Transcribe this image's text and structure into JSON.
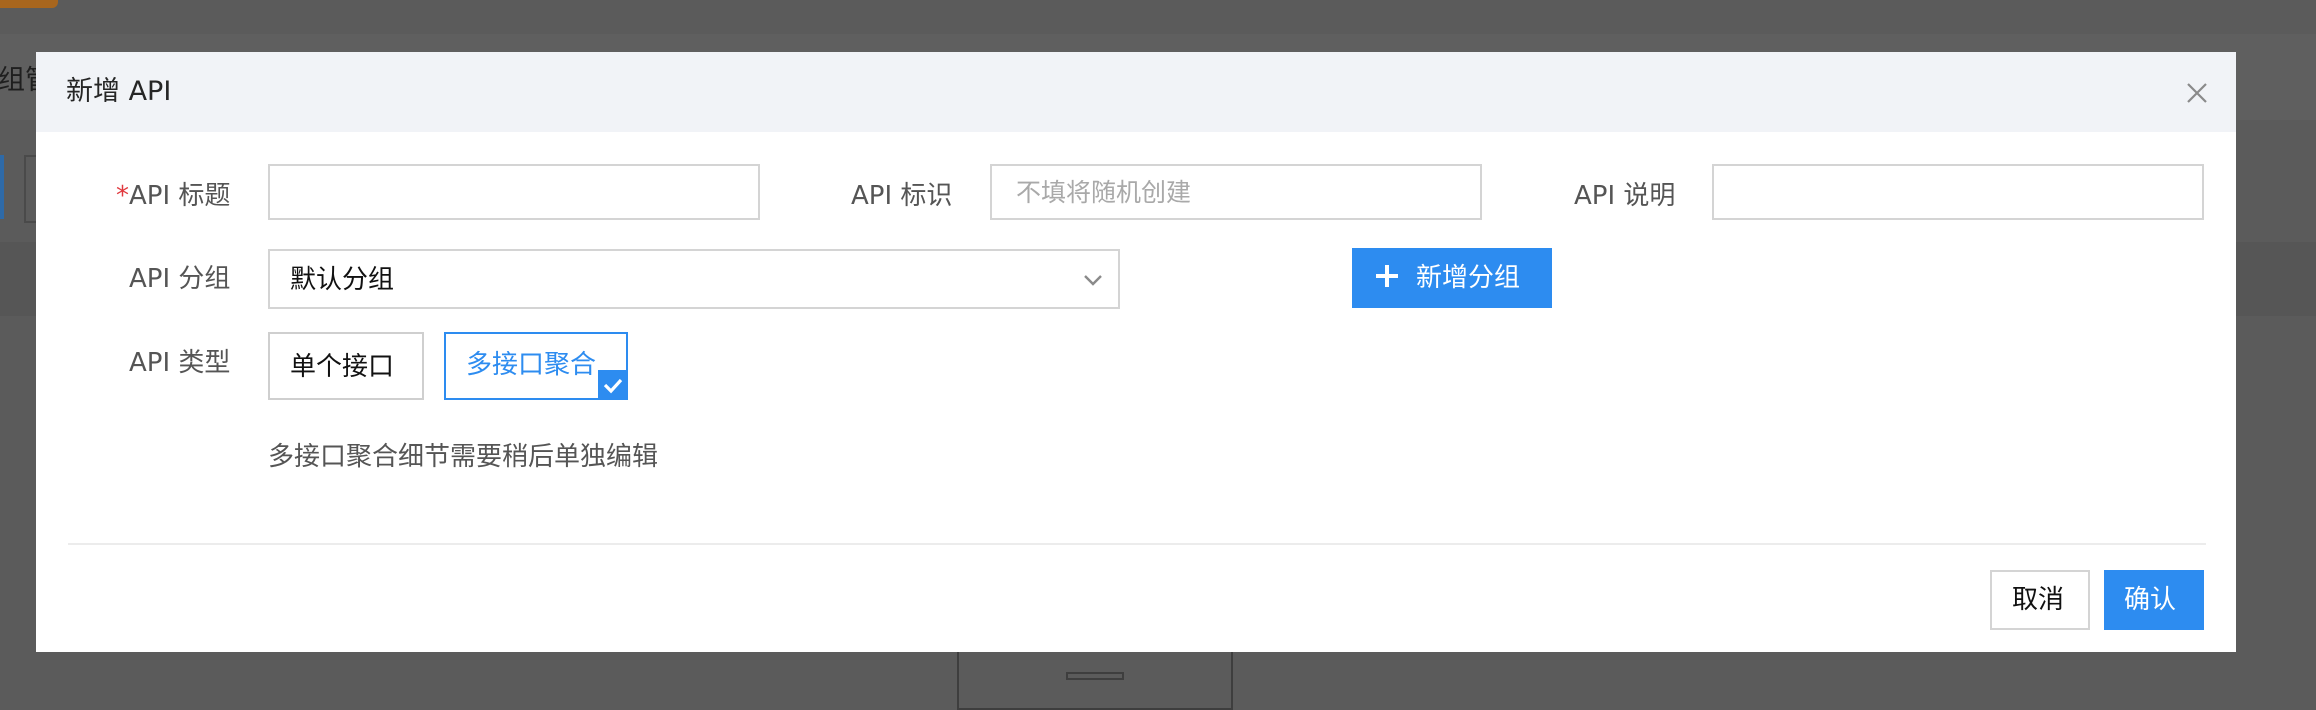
{
  "background": {
    "tab_text": "组管"
  },
  "dialog": {
    "title": "新增 API",
    "close_icon": "close-icon",
    "fields": {
      "title": {
        "required_mark": "*",
        "label": "API 标题",
        "value": "",
        "placeholder": ""
      },
      "identifier": {
        "label": "API 标识",
        "value": "",
        "placeholder": "不填将随机创建"
      },
      "description": {
        "label": "API 说明",
        "value": "",
        "placeholder": ""
      },
      "group": {
        "label": "API 分组",
        "selected": "默认分组"
      },
      "type": {
        "label": "API 类型",
        "options": [
          "单个接口",
          "多接口聚合"
        ],
        "selected": "多接口聚合"
      }
    },
    "add_group_button": "新增分组",
    "hint": "多接口聚合细节需要稍后单独编辑",
    "footer": {
      "cancel": "取消",
      "confirm": "确认"
    },
    "colors": {
      "primary": "#2d8cf0",
      "required": "#e0393e",
      "header_bg": "#f1f3f7"
    }
  }
}
